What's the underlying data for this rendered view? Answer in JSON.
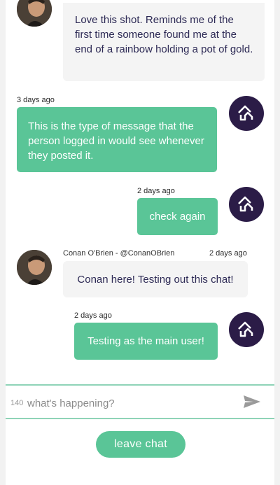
{
  "messages": [
    {
      "text": "Love this shot. Reminds me of the first time someone found me at the end of a rainbow holding a pot of gold."
    },
    {
      "timestamp": "3 days ago",
      "text": "This is the type of message that the person logged in would see whenever they posted it."
    },
    {
      "timestamp": "2 days ago",
      "text": "check again"
    },
    {
      "author": "Conan O'Brien - @ConanOBrien",
      "timestamp": "2 days ago",
      "text": "Conan here! Testing out this chat!"
    },
    {
      "timestamp": "2 days ago",
      "text": "Testing as the main user!"
    }
  ],
  "composer": {
    "char_count": "140",
    "placeholder": "what's happening?"
  },
  "actions": {
    "leave_label": "leave chat"
  },
  "colors": {
    "accent_green": "#5ac597",
    "brand_purple": "#2b1c47",
    "grey_bubble": "#f4f4f4",
    "text_dark": "#2d2a55"
  },
  "icons": {
    "brand_avatar": "house-logo-icon",
    "send": "send-icon"
  }
}
